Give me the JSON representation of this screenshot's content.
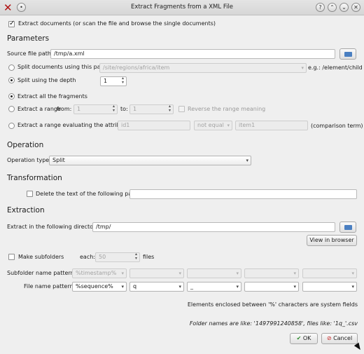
{
  "window": {
    "title": "Extract Fragments from a XML File"
  },
  "top_check": {
    "label": "Extract documents (or scan the file and browse the single documents)"
  },
  "parameters": {
    "heading": "Parameters",
    "source_label": "Source file path:",
    "source_value": "/tmp/a.xml",
    "split_path_label": "Split documents using this path:",
    "split_path_value": "/site/regions/africa/item",
    "split_path_hint": "e.g.: /element/child",
    "split_depth_label": "Split using the depth",
    "split_depth_value": "1",
    "extract_all_label": "Extract all the fragments",
    "extract_range_label": "Extract a range",
    "from_label": "from:",
    "from_value": "1",
    "to_label": "to:",
    "to_value": "1",
    "reverse_label": "Reverse the range meaning",
    "attr_label": "Extract a range evaluating the attribute",
    "attr_value": "id1",
    "attr_op": "not equal",
    "attr_cmp": "item1",
    "attr_hint": "(comparison term)"
  },
  "operation": {
    "heading": "Operation",
    "type_label": "Operation type:",
    "type_value": "Split"
  },
  "transformation": {
    "heading": "Transformation",
    "delete_label": "Delete the text of the following path",
    "delete_value": ""
  },
  "extraction": {
    "heading": "Extraction",
    "dir_label": "Extract in the following directory:",
    "dir_value": "/tmp/",
    "view_browser": "View in browser",
    "subfolders_label": "Make subfolders",
    "each_label": "each:",
    "each_value": "50",
    "files_label": "files",
    "subfolder_pattern_label": "Subfolder name pattern:",
    "subfolder_pattern": [
      "%timestamp%",
      "",
      "",
      "",
      ""
    ],
    "file_pattern_label": "File name pattern:",
    "file_pattern": [
      "%sequence%",
      "q",
      "_",
      "",
      ""
    ],
    "note": "Elements enclosed between '%' characters are system fields",
    "example": "Folder names are like: '1497991240858', files like: '1q_'.csv"
  },
  "buttons": {
    "ok": "OK",
    "cancel": "Cancel"
  },
  "colors": {
    "accent": "#4a7fc1",
    "ok_check": "#2e8b2e",
    "cancel_icon": "#c62828"
  }
}
